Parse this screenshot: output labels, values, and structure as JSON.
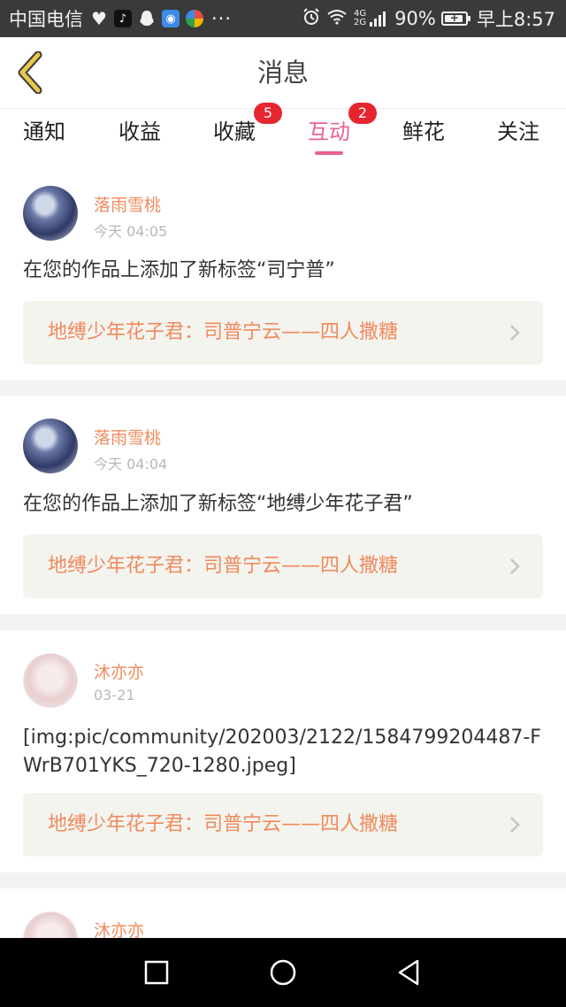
{
  "status_bar": {
    "carrier": "中国电信",
    "more": "···",
    "battery_percent": "90%",
    "battery_level": 0.9,
    "time": "早上8:57",
    "network_line1": "4G",
    "network_line2": "2G",
    "icons": [
      "heart-app-icon",
      "tiktok-icon",
      "qq-penguin-icon",
      "blue-app-icon",
      "multicolor-app-icon",
      "alarm-icon",
      "wifi-icon",
      "signal-icon",
      "battery-charging-icon"
    ]
  },
  "header": {
    "title": "消息",
    "back_icon": "chevron-left-icon",
    "back_color": "#e8c74a"
  },
  "tabs": [
    {
      "label": "通知",
      "badge": null,
      "active": false
    },
    {
      "label": "收益",
      "badge": null,
      "active": false
    },
    {
      "label": "收藏",
      "badge": "5",
      "active": false
    },
    {
      "label": "互动",
      "badge": "2",
      "active": true
    },
    {
      "label": "鲜花",
      "badge": null,
      "active": false
    },
    {
      "label": "关注",
      "badge": null,
      "active": false
    }
  ],
  "colors": {
    "accent": "#e8628e",
    "username": "#f08a5d",
    "badge": "#e6252f",
    "link_bg": "#f4f4ef"
  },
  "feed": [
    {
      "username": "落雨雪桃",
      "time": "今天 04:05",
      "message": "在您的作品上添加了新标签“司宁普”",
      "work_title": "地缚少年花子君：司普宁云——四人撒糖"
    },
    {
      "username": "落雨雪桃",
      "time": "今天 04:04",
      "message": "在您的作品上添加了新标签“地缚少年花子君”",
      "work_title": "地缚少年花子君：司普宁云——四人撒糖"
    },
    {
      "username": "沐亦亦",
      "time": "03-21",
      "message": "[img:pic/community/202003/2122/1584799204487-FWrB701YKS_720-1280.jpeg]",
      "work_title": "地缚少年花子君：司普宁云——四人撒糖"
    },
    {
      "username": "沐亦亦",
      "time": "",
      "message": "",
      "work_title": ""
    }
  ],
  "navbar": {
    "buttons": [
      "recent-apps-square-icon",
      "home-circle-icon",
      "back-triangle-icon"
    ]
  }
}
